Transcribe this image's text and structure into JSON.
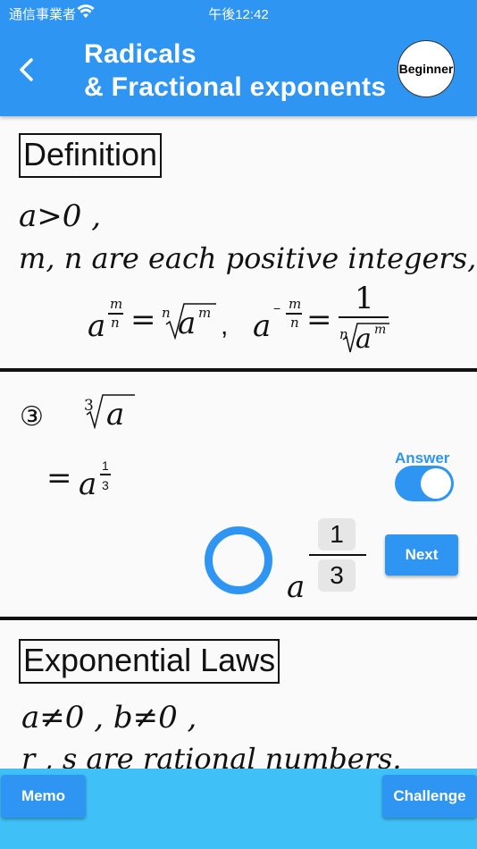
{
  "status_bar": {
    "carrier": "通信事業者",
    "time": "午後12:42"
  },
  "header": {
    "title_line1": "Radicals",
    "title_line2": "& Fractional exponents",
    "level_badge": "Beginner"
  },
  "definition": {
    "heading": "Definition",
    "condition_1": "a>0 ,",
    "condition_2": "m, n  are each positive integers,",
    "base": "a",
    "exp_m": "m",
    "exp_n": "n",
    "root_index": "n",
    "radicand_base": "a",
    "radicand_exp": "m",
    "comma": ",",
    "neg_base": "a",
    "neg_sign": "−",
    "neg_m": "m",
    "neg_n": "n",
    "one": "1",
    "den_index": "n",
    "den_base": "a",
    "den_exp": "m",
    "equals": "="
  },
  "problem": {
    "number": "③",
    "root_index": "3",
    "radicand": "a",
    "answer_equals": "=",
    "answer_base": "a",
    "answer_num": "1",
    "answer_den": "3",
    "answer_toggle_label": "Answer",
    "answer_toggle_on": true,
    "input_base": "a",
    "input_num": "1",
    "input_den": "3",
    "next_label": "Next"
  },
  "exponential_laws": {
    "heading": "Exponential Laws",
    "condition_1": "a≠0 , b≠0 ,",
    "condition_2": "r , s  are rational numbers."
  },
  "footer": {
    "memo_label": "Memo",
    "challenge_label": "Challenge"
  },
  "colors": {
    "primary": "#2f95f3",
    "footer": "#3fc0f6"
  },
  "icons": {
    "back": "chevron-left-icon",
    "wifi": "wifi-icon",
    "result": "circle-correct-icon"
  }
}
